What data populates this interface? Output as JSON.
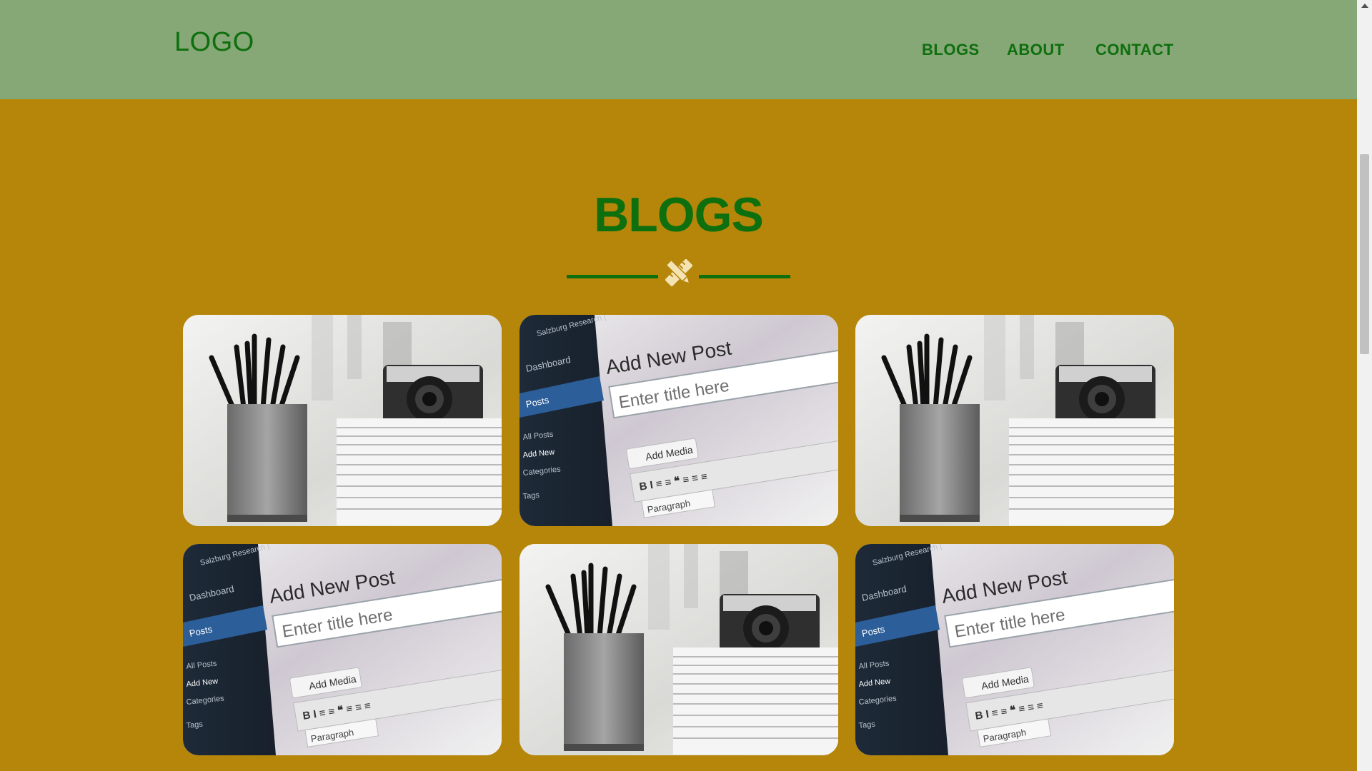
{
  "header": {
    "logo": "LOGO",
    "nav": [
      {
        "label": "BLOGS"
      },
      {
        "label": "ABOUT"
      },
      {
        "label": "CONTACT"
      }
    ]
  },
  "blogs": {
    "title": "BLOGS",
    "divider_icon": "pencil-ruler-icon",
    "cards": [
      {
        "image": "pencils-camera-photo"
      },
      {
        "image": "add-new-post-photo"
      },
      {
        "image": "pencils-camera-photo"
      },
      {
        "image": "add-new-post-photo"
      },
      {
        "image": "pencils-camera-photo"
      },
      {
        "image": "add-new-post-photo"
      }
    ],
    "editor_photo_text": {
      "heading": "Add New Post",
      "input": "Enter title here",
      "button": "Add Media",
      "menu": [
        "Dashboard",
        "Posts",
        "All Posts",
        "Add New",
        "Categories",
        "Tags"
      ],
      "breadcrumb": "Salzburg Research |",
      "format_select": "Paragraph"
    }
  },
  "colors": {
    "header_bg": "#86a776",
    "page_bg": "#b5860a",
    "accent_green": "#0e6f0e",
    "divider_icon_color": "#f4e3b3"
  }
}
